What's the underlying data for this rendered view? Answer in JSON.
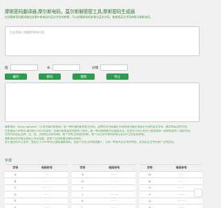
{
  "header": {
    "title": "摩斯密码翻译器,摩尔斯电码，莫尔斯解密密工具,摩斯密码生成器",
    "subtitle": "在线摩斯密码翻译器包含摩尔斯电码对英文字母的转换，可以把摩斯电码转换为英文字母，能够把英文字母转换为摩斯电码。"
  },
  "input": {
    "placeholder": "在这里输入需要转换的内容"
  },
  "options": {
    "short_label": "短",
    "long_label": "长",
    "sep_label": "分隔"
  },
  "buttons": {
    "encode": "编码",
    "decode": "解码",
    "play": "播放",
    "stop": "停止"
  },
  "output": {
    "placeholder": ""
  },
  "description": [
    "摩斯电码（Morse alphabet）（又译为摩尔斯电码）是一种时通时断的信号代码，这种信号代码通过不同的排列顺序来表达不同的英文字母、数字和标点符号等。",
    "它由美国人萨缪尔·摩尔斯于1837年发明，为摩尔斯电报发明提供了条件。是一种早期的数字化通信形式，但是它不同于现代只使用零和一两种状态的二进制代码，",
    "它的代码包括五种：点、划、点和划之间的停顿、每个字符之间短的停顿、每个词之间中等的停顿以及句子之间长的停顿。",
    "摩斯电码在早期无线电上举足轻重，是每个无线电通讯者所必知的。",
    "由于通讯技术之进步，各国已于1999年停止使用摩斯电码，但由于它所占的频宽最少，又具一种技术及艺术的特性，在实际生活中仍有广泛的应用。"
  ],
  "table": {
    "section_title": "字母",
    "headers": [
      "字符",
      "电码符号"
    ],
    "columns": [
      [
        [
          "A",
          "· −"
        ],
        [
          "B",
          "− · · ·"
        ],
        [
          "C",
          "− · − ·"
        ],
        [
          "D",
          "− · ·"
        ],
        [
          "E",
          "·"
        ],
        [
          "F",
          "· · − ·"
        ]
      ],
      [
        [
          "G",
          "− − ·"
        ],
        [
          "H",
          "· · · ·"
        ],
        [
          "I",
          "· ·"
        ],
        [
          "J",
          "· − − −"
        ],
        [
          "K",
          "− · −"
        ],
        [
          "L",
          "· − · ·"
        ]
      ],
      [
        [
          "M",
          "− −"
        ],
        [
          "N",
          "− ·"
        ],
        [
          "O",
          "− − −"
        ],
        [
          "P",
          "· − − ·"
        ],
        [
          "Q",
          "− − · −"
        ],
        [
          "R",
          "· − ·"
        ]
      ]
    ]
  },
  "colors": {
    "accent": "#2e9b4e",
    "heading": "#2a7a2a"
  }
}
